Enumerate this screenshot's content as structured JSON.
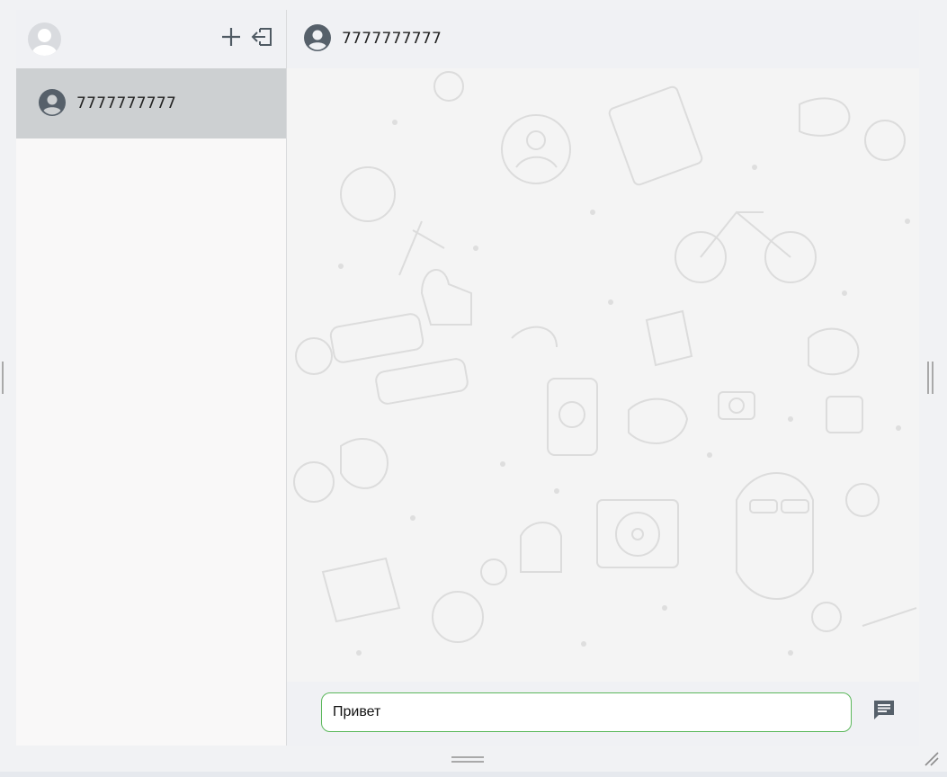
{
  "sidebar": {
    "icons": {
      "avatar": "user-avatar-placeholder",
      "new_chat": "plus-icon",
      "logout": "logout-icon"
    },
    "chats": [
      {
        "name": "7777777777",
        "icon": "user-circle-icon",
        "active": true
      }
    ]
  },
  "chat": {
    "header_name": "7777777777",
    "input_value": "Привет",
    "send_icon": "message-send-icon"
  },
  "colors": {
    "active_chat": "#cdd0d2",
    "input_border": "#5cb85c",
    "icon": "#4f5a63",
    "header_bg": "#f0f1f4"
  }
}
